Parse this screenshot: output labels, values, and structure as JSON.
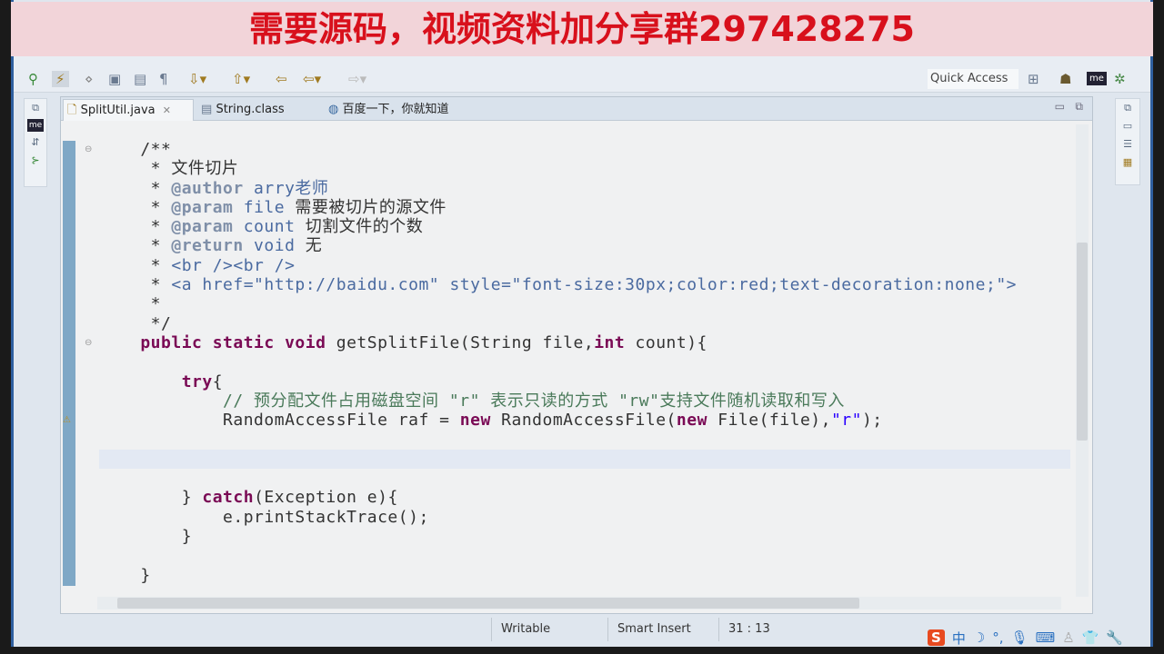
{
  "banner": {
    "text": "需要源码，视频资料加分享群297428275"
  },
  "toolbar": {
    "quick_access": "Quick Access"
  },
  "tabs": [
    {
      "label": "SplitUtil.java",
      "close": "✕"
    },
    {
      "label": "String.class"
    },
    {
      "label": "百度一下，你就知道"
    }
  ],
  "code": [
    [
      [
        "plain",
        "    /**"
      ]
    ],
    [
      [
        "plain",
        "     * 文件切片"
      ]
    ],
    [
      [
        "plain",
        "     * "
      ],
      [
        "tag",
        "@author"
      ],
      [
        "jd",
        " arry老师"
      ]
    ],
    [
      [
        "plain",
        "     * "
      ],
      [
        "tag",
        "@param"
      ],
      [
        "jd",
        " file"
      ],
      [
        "plain",
        " 需要被切片的源文件"
      ]
    ],
    [
      [
        "plain",
        "     * "
      ],
      [
        "tag",
        "@param"
      ],
      [
        "jd",
        " count"
      ],
      [
        "plain",
        " 切割文件的个数"
      ]
    ],
    [
      [
        "plain",
        "     * "
      ],
      [
        "tag",
        "@return"
      ],
      [
        "jd",
        " void"
      ],
      [
        "plain",
        " 无"
      ]
    ],
    [
      [
        "plain",
        "     * "
      ],
      [
        "jd",
        "<br /><br />"
      ]
    ],
    [
      [
        "plain",
        "     * "
      ],
      [
        "jd",
        "<a href=\"http://baidu.com\" style=\"font-size:30px;color:red;text-decoration:none;\">"
      ]
    ],
    [
      [
        "plain",
        "     *"
      ]
    ],
    [
      [
        "plain",
        "     */"
      ]
    ],
    [
      [
        "kw",
        "    public static void "
      ],
      [
        "plain",
        "getSplitFile(String file,"
      ],
      [
        "kw",
        "int"
      ],
      [
        "plain",
        " count){"
      ]
    ],
    [
      [
        "plain",
        ""
      ]
    ],
    [
      [
        "kw",
        "        try"
      ],
      [
        "plain",
        "{"
      ]
    ],
    [
      [
        "cm",
        "            // 预分配文件占用磁盘空间 \"r\" 表示只读的方式 \"rw\"支持文件随机读取和写入"
      ]
    ],
    [
      [
        "plain",
        "            RandomAccessFile raf = "
      ],
      [
        "kw",
        "new"
      ],
      [
        "plain",
        " RandomAccessFile("
      ],
      [
        "kw",
        "new"
      ],
      [
        "plain",
        " File(file),"
      ],
      [
        "str",
        "\"r\""
      ],
      [
        "plain",
        ");"
      ]
    ],
    [
      [
        "plain",
        ""
      ]
    ],
    [
      [
        "plain",
        ""
      ]
    ],
    [
      [
        "plain",
        ""
      ]
    ],
    [
      [
        "plain",
        "        } "
      ],
      [
        "kw",
        "catch"
      ],
      [
        "plain",
        "(Exception e){"
      ]
    ],
    [
      [
        "plain",
        "            e.printStackTrace();"
      ]
    ],
    [
      [
        "plain",
        "        }"
      ]
    ],
    [
      [
        "plain",
        ""
      ]
    ],
    [
      [
        "plain",
        "    }"
      ]
    ]
  ],
  "current_line_index": 16,
  "status": {
    "mode": "Writable",
    "insert": "Smart Insert",
    "position": "31 : 13"
  },
  "ime": {
    "logo": "S",
    "lang": "中"
  }
}
